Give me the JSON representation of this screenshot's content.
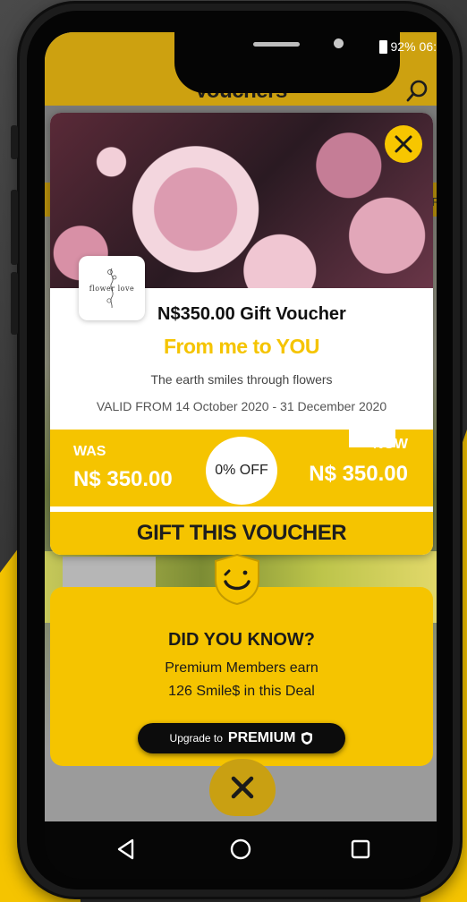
{
  "status": {
    "battery_pct": "92%",
    "time": "06:"
  },
  "header": {
    "title": "Vouchers"
  },
  "background": {
    "side_label": "R"
  },
  "voucher": {
    "merchant_logo_text": "flower love",
    "title": "N$350.00 Gift Voucher",
    "subtitle": "From me to YOU",
    "description": "The earth smiles through flowers",
    "validity": "VALID FROM 14 October 2020 - 31 December 2020",
    "was_label": "WAS",
    "was_price": "N$ 350.00",
    "discount": "0% OFF",
    "now_label": "NOW",
    "now_price": "N$ 350.00",
    "cta": "GIFT THIS VOUCHER"
  },
  "did_you_know": {
    "title": "DID YOU KNOW?",
    "line1": "Premium Members earn",
    "line2": "126 Smile$ in this Deal",
    "upgrade_prefix": "Upgrade to",
    "upgrade_label": "PREMIUM"
  },
  "colors": {
    "accent": "#f5c400",
    "header": "#cda110",
    "dark": "#0c0c0c"
  },
  "icons": [
    "search-icon",
    "close-icon",
    "smiley-shield-icon",
    "shield-icon",
    "back-icon",
    "home-icon",
    "recents-icon"
  ]
}
